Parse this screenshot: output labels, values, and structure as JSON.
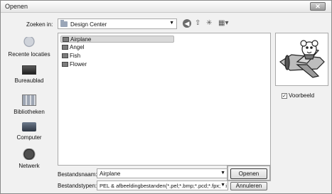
{
  "window": {
    "title": "Openen",
    "close_glyph": "✕"
  },
  "toolbar": {
    "look_in_label": "Zoeken in:",
    "look_in_value": "Design Center",
    "icons": [
      "back-icon",
      "up-folder-icon",
      "new-folder-icon",
      "view-menu-icon"
    ]
  },
  "places": [
    {
      "label": "Recente locaties",
      "icon": "recent-places-icon"
    },
    {
      "label": "Bureaublad",
      "icon": "desktop-icon"
    },
    {
      "label": "Bibliotheken",
      "icon": "libraries-icon"
    },
    {
      "label": "Computer",
      "icon": "computer-icon"
    },
    {
      "label": "Netwerk",
      "icon": "network-icon"
    }
  ],
  "files": [
    {
      "name": "Airplane",
      "selected": true
    },
    {
      "name": "Angel",
      "selected": false
    },
    {
      "name": "Fish",
      "selected": false
    },
    {
      "name": "Flower",
      "selected": false
    }
  ],
  "preview": {
    "checkbox_label": "Voorbeeld",
    "checked": true,
    "check_glyph": "✓"
  },
  "footer": {
    "filename_label": "Bestandsnaam:",
    "filename_value": "Airplane",
    "filetype_label": "Bestandstypen:",
    "filetype_value": "PEL & afbeeldingbestanden(*.pel;*.bmp;*.pcd;*.fpx;*.ti",
    "open_button": "Openen",
    "cancel_button": "Annuleren"
  }
}
